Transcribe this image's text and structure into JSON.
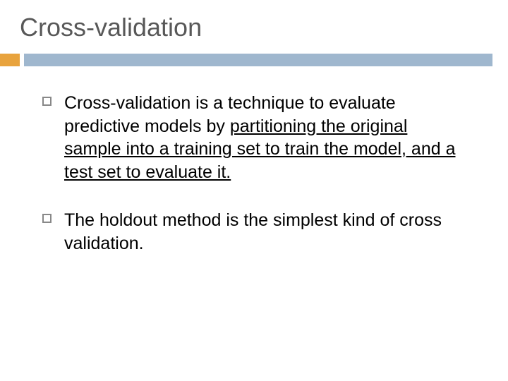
{
  "title": "Cross-validation",
  "bullets": [
    {
      "pre": "Cross-validation is a technique to evaluate predictive models by ",
      "underlined": "partitioning the original sample into a training set to train the model, and a test set to evaluate it."
    },
    {
      "pre": "The holdout method is the simplest kind of cross validation.",
      "underlined": ""
    }
  ]
}
